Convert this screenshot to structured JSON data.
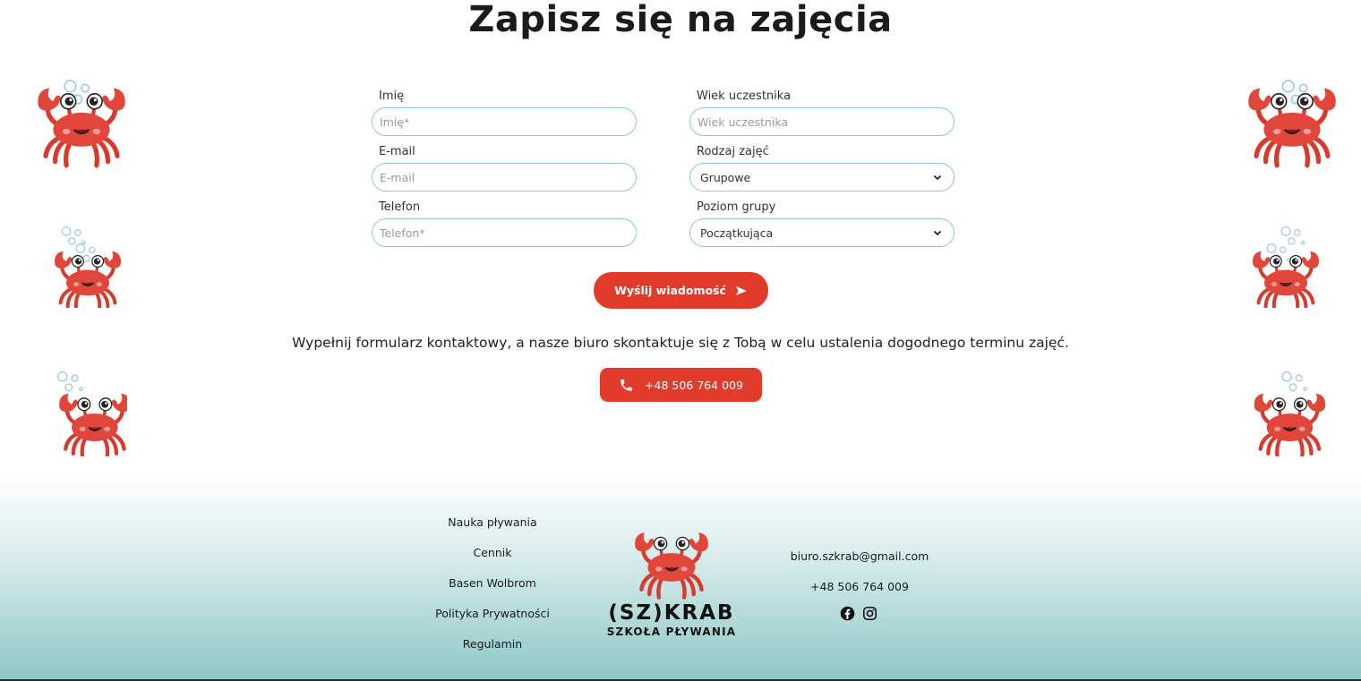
{
  "page": {
    "title": "Zapisz się na zajęcia"
  },
  "form": {
    "name": {
      "label": "Imię",
      "placeholder": "Imię*"
    },
    "email": {
      "label": "E-mail",
      "placeholder": "E-mail"
    },
    "phone": {
      "label": "Telefon",
      "placeholder": "Telefon*"
    },
    "age": {
      "label": "Wiek uczestnika",
      "placeholder": "Wiek uczestnika"
    },
    "class_type": {
      "label": "Rodzaj zajęć",
      "selected": "Grupowe"
    },
    "group_level": {
      "label": "Poziom grupy",
      "selected": "Początkująca"
    },
    "submit_label": "Wyślij wiadomość"
  },
  "info": {
    "text": "Wypełnij formularz kontaktowy, a nasze biuro skontaktuje się z Tobą w celu ustalenia dogodnego terminu zajęć.",
    "phone_button": "+48 506 764 009"
  },
  "footer": {
    "links": [
      "Nauka pływania",
      "Cennik",
      "Basen Wolbrom",
      "Polityka Prywatności",
      "Regulamin"
    ],
    "logo_line1": "(SZ)KRAB",
    "logo_line2": "SZKOŁA PŁYWANIA",
    "email": "biuro.szkrab@gmail.com",
    "phone": "+48 506 764 009",
    "social": [
      "facebook-icon",
      "instagram-icon"
    ]
  },
  "colors": {
    "accent_red": "#e23b2c",
    "field_border": "#8fc9c8",
    "footer_teal": "#8dc7c5"
  }
}
